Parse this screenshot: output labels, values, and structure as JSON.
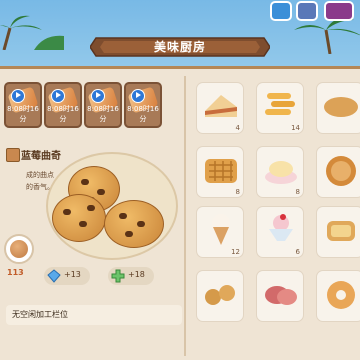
{
  "title": "美味厨房",
  "queue": [
    {
      "time": "8:08时16分"
    },
    {
      "time": "8:08时16分"
    },
    {
      "time": "8:08时16分"
    },
    {
      "time": "8:08时16分"
    }
  ],
  "recipe": {
    "name": "蓝莓曲奇",
    "desc_line1": "成的曲点",
    "desc_line2": "的香气。",
    "egg_count": "113",
    "cost_items": [
      {
        "icon": "blue-gem-icon",
        "value": "+13"
      },
      {
        "icon": "green-cross-icon",
        "value": "+18"
      }
    ]
  },
  "status": {
    "idle_text": "无空闲加工栏位"
  },
  "inventory": [
    {
      "icon": "cake-slice-icon",
      "count": "4"
    },
    {
      "icon": "fries-icon",
      "count": "14"
    },
    {
      "icon": "bread-icon",
      "count": ""
    },
    {
      "icon": "waffle-icon",
      "count": "8"
    },
    {
      "icon": "pudding-icon",
      "count": "8"
    },
    {
      "icon": "pie-icon",
      "count": ""
    },
    {
      "icon": "ice-cream-icon",
      "count": "12"
    },
    {
      "icon": "sundae-icon",
      "count": "6"
    },
    {
      "icon": "toast-icon",
      "count": ""
    },
    {
      "icon": "cookies-icon",
      "count": ""
    },
    {
      "icon": "ham-icon",
      "count": ""
    },
    {
      "icon": "donut-icon",
      "count": ""
    }
  ]
}
